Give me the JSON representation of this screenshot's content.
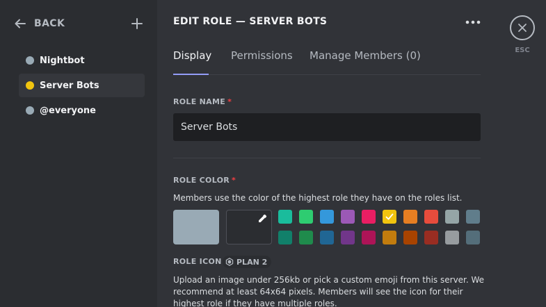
{
  "sidebar": {
    "back_label": "BACK",
    "roles": [
      {
        "label": "Nightbot",
        "color": "#99aab5",
        "selected": false
      },
      {
        "label": "Server Bots",
        "color": "#f1c40f",
        "selected": true
      },
      {
        "label": "@everyone",
        "color": "#99aab5",
        "selected": false
      }
    ]
  },
  "header": {
    "title": "EDIT ROLE — SERVER BOTS"
  },
  "tabs": [
    {
      "label": "Display",
      "active": true
    },
    {
      "label": "Permissions",
      "active": false
    },
    {
      "label": "Manage Members (0)",
      "active": false
    }
  ],
  "role_name": {
    "label": "ROLE NAME",
    "required_mark": "*",
    "value": "Server Bots"
  },
  "role_color": {
    "label": "ROLE COLOR",
    "required_mark": "*",
    "helper": "Members use the color of the highest role they have on the roles list.",
    "default_color": "#99aab5",
    "swatches_row1": [
      "#1abc9c",
      "#2ecc71",
      "#3498db",
      "#9b59b6",
      "#e91e63",
      "#f1c40f",
      "#e67e22",
      "#e74c3c",
      "#95a5a6",
      "#607d8b"
    ],
    "swatches_row2": [
      "#11806a",
      "#1f8b4c",
      "#206694",
      "#71368a",
      "#ad1457",
      "#c27c0e",
      "#a84300",
      "#992d22",
      "#979c9f",
      "#546e7a"
    ],
    "selected_swatch": "#f1c40f"
  },
  "role_icon": {
    "label": "ROLE ICON",
    "badge": "PLAN 2",
    "helper_lines": [
      "Upload an image under 256kb or pick a custom emoji from this server. We",
      "recommend at least 64x64 pixels. Members will see the icon for their",
      "highest role if they have multiple roles."
    ]
  },
  "close": {
    "esc_label": "ESC"
  },
  "accent": "#949cf7"
}
